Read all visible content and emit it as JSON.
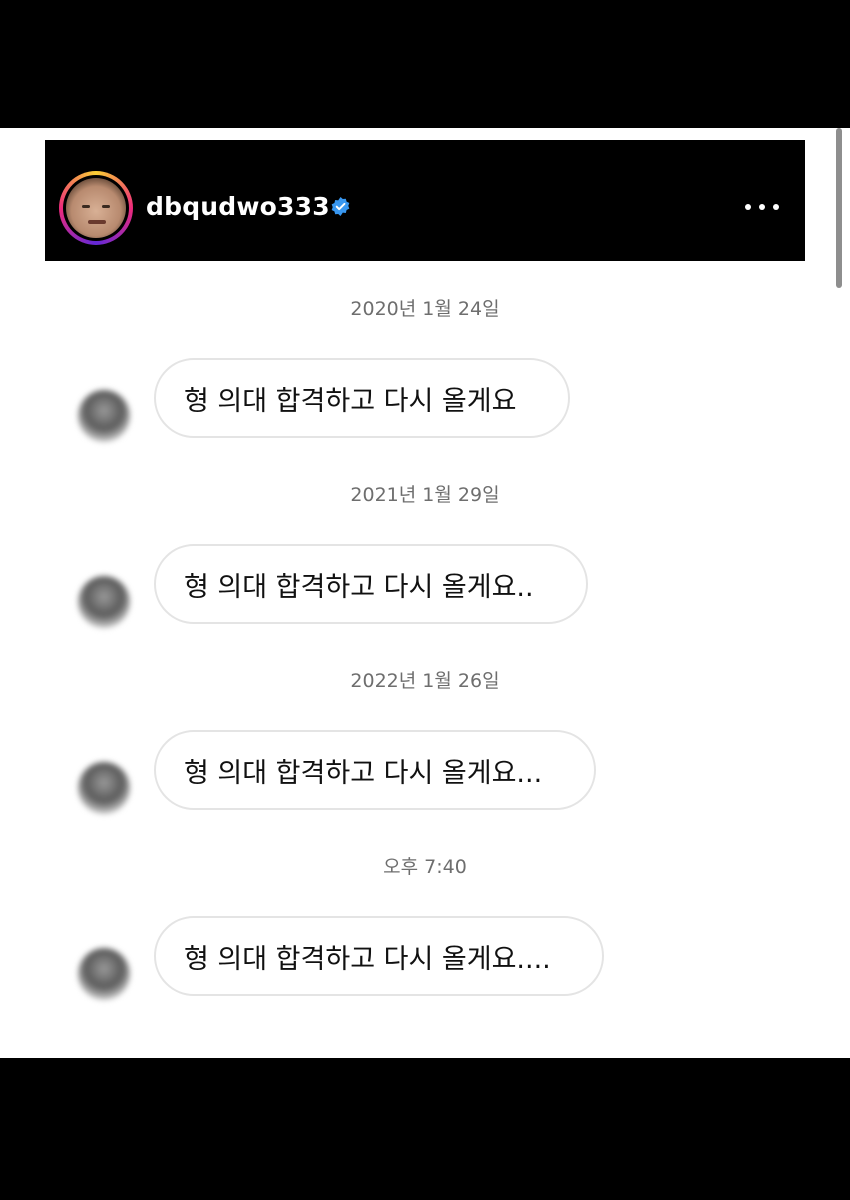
{
  "header": {
    "username": "dbqudwo333",
    "verified_icon": "verified-badge-icon",
    "more_icon": "more-horizontal-icon"
  },
  "messages": [
    {
      "date": "2020년 1월 24일",
      "text": "형 의대 합격하고 다시 올게요"
    },
    {
      "date": "2021년 1월 29일",
      "text": "형 의대 합격하고 다시 올게요.."
    },
    {
      "date": "2022년 1월 26일",
      "text": "형 의대 합격하고 다시 올게요..."
    },
    {
      "date": "오후 7:40",
      "text": "형 의대 합격하고 다시 올게요...."
    }
  ],
  "colors": {
    "header_bg": "#000000",
    "bubble_border": "#e4e4e4",
    "verified_blue": "#3897f0"
  }
}
